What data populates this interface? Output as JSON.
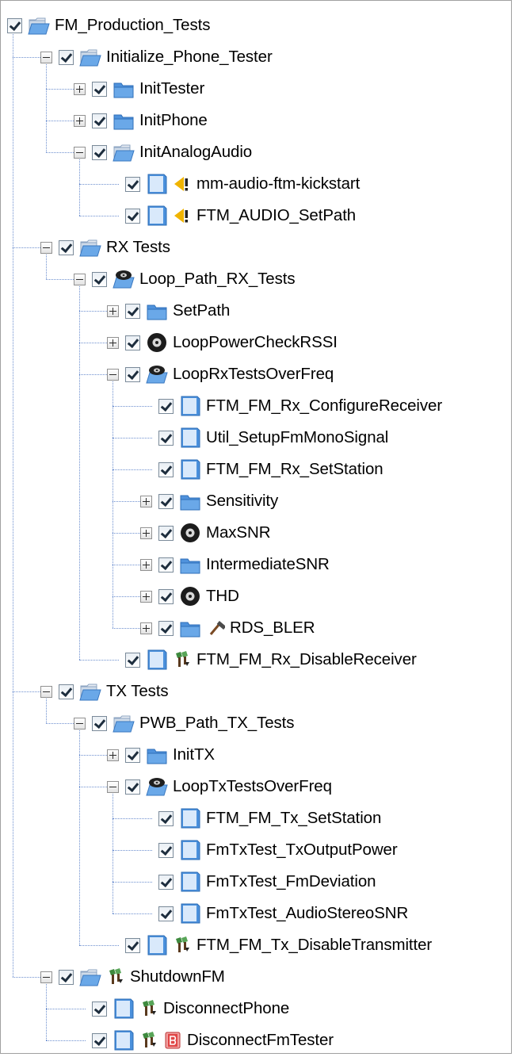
{
  "tree": {
    "nodes": [
      {
        "label": "FM_Production_Tests",
        "level": 0,
        "expander": "none",
        "icon": "folder-open-icon"
      },
      {
        "label": "Initialize_Phone_Tester",
        "level": 1,
        "expander": "minus",
        "icon": "folder-open-icon"
      },
      {
        "label": "InitTester",
        "level": 2,
        "expander": "plus",
        "icon": "folder-closed-icon"
      },
      {
        "label": "InitPhone",
        "level": 2,
        "expander": "plus",
        "icon": "folder-closed-icon"
      },
      {
        "label": "InitAnalogAudio",
        "level": 2,
        "expander": "minus",
        "icon": "folder-open-icon"
      },
      {
        "label": "mm-audio-ftm-kickstart",
        "level": 3,
        "expander": "none",
        "icon": "step-icon",
        "extra": "warning-icon"
      },
      {
        "label": "FTM_AUDIO_SetPath",
        "level": 3,
        "expander": "none",
        "icon": "step-icon",
        "extra": "warning-icon"
      },
      {
        "label": "RX Tests",
        "level": 1,
        "expander": "minus",
        "icon": "folder-open-icon"
      },
      {
        "label": "Loop_Path_RX_Tests",
        "level": 2,
        "expander": "minus",
        "icon": "loop-folder-icon"
      },
      {
        "label": "SetPath",
        "level": 3,
        "expander": "plus",
        "icon": "folder-closed-icon"
      },
      {
        "label": "LoopPowerCheckRSSI",
        "level": 3,
        "expander": "plus",
        "icon": "disc-icon"
      },
      {
        "label": "LoopRxTestsOverFreq",
        "level": 3,
        "expander": "minus",
        "icon": "loop-folder-icon"
      },
      {
        "label": "FTM_FM_Rx_ConfigureReceiver",
        "level": 4,
        "expander": "none",
        "icon": "step-icon"
      },
      {
        "label": "Util_SetupFmMonoSignal",
        "level": 4,
        "expander": "none",
        "icon": "step-icon"
      },
      {
        "label": "FTM_FM_Rx_SetStation",
        "level": 4,
        "expander": "none",
        "icon": "step-icon"
      },
      {
        "label": "Sensitivity",
        "level": 4,
        "expander": "plus",
        "icon": "folder-closed-icon"
      },
      {
        "label": "MaxSNR",
        "level": 4,
        "expander": "plus",
        "icon": "disc-icon"
      },
      {
        "label": "IntermediateSNR",
        "level": 4,
        "expander": "plus",
        "icon": "folder-closed-icon"
      },
      {
        "label": "THD",
        "level": 4,
        "expander": "plus",
        "icon": "disc-icon"
      },
      {
        "label": "RDS_BLER",
        "level": 4,
        "expander": "plus",
        "icon": "folder-closed-icon",
        "extra": "hammer-icon"
      },
      {
        "label": "FTM_FM_Rx_DisableReceiver",
        "level": 3,
        "expander": "none",
        "icon": "step-icon",
        "extra": "cleanup-icon"
      },
      {
        "label": "TX Tests",
        "level": 1,
        "expander": "minus",
        "icon": "folder-open-icon"
      },
      {
        "label": "PWB_Path_TX_Tests",
        "level": 2,
        "expander": "minus",
        "icon": "folder-open-icon"
      },
      {
        "label": "InitTX",
        "level": 3,
        "expander": "plus",
        "icon": "folder-closed-icon"
      },
      {
        "label": "LoopTxTestsOverFreq",
        "level": 3,
        "expander": "minus",
        "icon": "loop-folder-icon"
      },
      {
        "label": "FTM_FM_Tx_SetStation",
        "level": 4,
        "expander": "none",
        "icon": "step-icon"
      },
      {
        "label": "FmTxTest_TxOutputPower",
        "level": 4,
        "expander": "none",
        "icon": "step-icon"
      },
      {
        "label": "FmTxTest_FmDeviation",
        "level": 4,
        "expander": "none",
        "icon": "step-icon"
      },
      {
        "label": "FmTxTest_AudioStereoSNR",
        "level": 4,
        "expander": "none",
        "icon": "step-icon"
      },
      {
        "label": "FTM_FM_Tx_DisableTransmitter",
        "level": 3,
        "expander": "none",
        "icon": "step-icon",
        "extra": "cleanup-icon"
      },
      {
        "label": "ShutdownFM",
        "level": 1,
        "expander": "minus",
        "icon": "folder-open-icon",
        "extra": "cleanup-icon"
      },
      {
        "label": "DisconnectPhone",
        "level": 2,
        "expander": "none",
        "icon": "step-icon",
        "extra": "cleanup-icon"
      },
      {
        "label": "DisconnectFmTester",
        "level": 2,
        "expander": "none",
        "icon": "step-icon",
        "extra": "cleanup-icon",
        "extra2": "breakpoint-icon"
      }
    ]
  },
  "colors": {
    "connector": "#6d8fcf",
    "folder": "#6aa8e8",
    "warning": "#f0b400",
    "breakpoint": "#e04545"
  }
}
